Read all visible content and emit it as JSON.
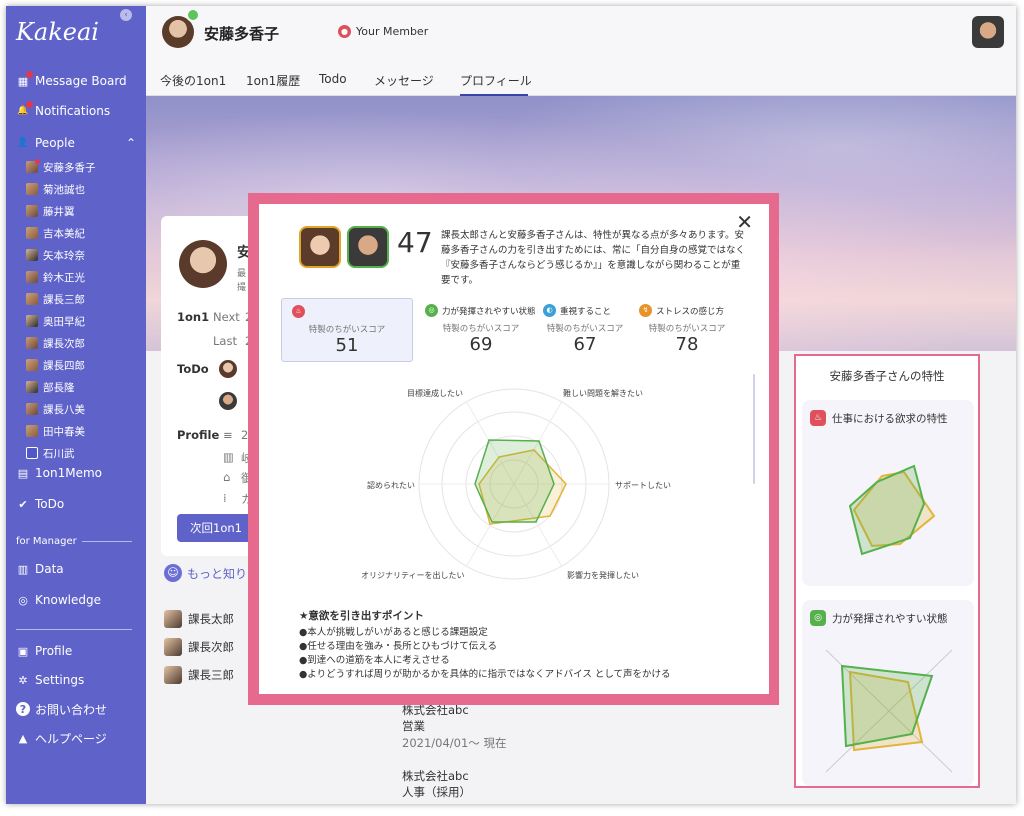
{
  "app": {
    "logo": "Kakeai",
    "collapse_glyph": "‹"
  },
  "sidebar": {
    "items": [
      {
        "label": "Message Board",
        "icon": "message-board-icon",
        "glyph": "▦",
        "badge": true
      },
      {
        "label": "Notifications",
        "icon": "bell-icon",
        "glyph": "🔔",
        "badge": true
      },
      {
        "label": "People",
        "icon": "person-icon",
        "glyph": "👤",
        "chevron": "⌃"
      }
    ],
    "people": [
      "安藤多香子",
      "菊池誠也",
      "藤井翼",
      "吉本美紀",
      "矢本玲奈",
      "鈴木正光",
      "課長三郎",
      "奥田早紀",
      "課長次郎",
      "課長四郎",
      "部長隆",
      "課長八美",
      "田中春美",
      "石川武"
    ],
    "items2": [
      {
        "label": "1on1Memo",
        "icon": "memo-icon",
        "glyph": "▤"
      },
      {
        "label": "ToDo",
        "icon": "check-icon",
        "glyph": "✔"
      }
    ],
    "manager_label": "for Manager",
    "manager_items": [
      {
        "label": "Data",
        "icon": "chart-icon",
        "glyph": "▥"
      },
      {
        "label": "Knowledge",
        "icon": "compass-icon",
        "glyph": "◎"
      }
    ],
    "bottom_items": [
      {
        "label": "Profile",
        "icon": "id-card-icon",
        "glyph": "▣"
      },
      {
        "label": "Settings",
        "icon": "gear-icon",
        "glyph": "✲"
      },
      {
        "label": "お問い合わせ",
        "icon": "help-icon",
        "glyph": "?"
      },
      {
        "label": "ヘルプページ",
        "icon": "graduation-cap-icon",
        "glyph": "▲"
      }
    ]
  },
  "header": {
    "name": "安藤多香子",
    "member_label": "Your Member",
    "tabs": [
      "今後の1on1",
      "1on1履歴",
      "Todo",
      "メッセージ",
      "プロフィール"
    ]
  },
  "profile_card": {
    "name_partial": "安",
    "line1": "最",
    "line2": "撮",
    "onone_label": "1on1",
    "next_label": "Next",
    "next_value": "2",
    "last_label": "Last",
    "last_value": "2",
    "todo_label": "ToDo",
    "profile_label": "Profile",
    "profile_v1": "2(",
    "profile_v2": "岐",
    "profile_v3": "御",
    "profile_v4": "カ",
    "next_button": "次回1on1"
  },
  "more_link": "もっと知りた",
  "bg_people": [
    "課長太郎",
    "課長次郎",
    "課長三郎"
  ],
  "career": {
    "company1": "株式会社abc",
    "role1": "営業",
    "period1": "2021/04/01〜 現在",
    "company2": "株式会社abc",
    "role2": "人事（採用）"
  },
  "traits_panel": {
    "title": "安藤多香子さんの特性",
    "cards": [
      {
        "label": "仕事における欲求の特性",
        "color": "#e0505a",
        "glyph": "♨"
      },
      {
        "label": "力が発揮されやすい状態",
        "color": "#56b04c",
        "glyph": "◎"
      }
    ]
  },
  "modal": {
    "close": "✕",
    "score": "47",
    "description": "課長太郎さんと安藤多香子さんは、特性が異なる点が多々あります。安藤多香子さんの力を引き出すためには、常に「自分自身の感覚ではなく『安藤多香子さんならどう感じるか』」を意識しながら関わることが重要です。",
    "tiles": [
      {
        "label": "",
        "sub": "特製のちがいスコア",
        "value": "51",
        "color": "#e0505a",
        "glyph": "♨"
      },
      {
        "label": "力が発揮されやすい状態",
        "sub": "特製のちがいスコア",
        "value": "69",
        "color": "#56b04c",
        "glyph": "◎"
      },
      {
        "label": "重視すること",
        "sub": "特製のちがいスコア",
        "value": "67",
        "color": "#3aa0d8",
        "glyph": "◐"
      },
      {
        "label": "ストレスの感じ方",
        "sub": "特製のちがいスコア",
        "value": "78",
        "color": "#e8922a",
        "glyph": "↯"
      }
    ],
    "radar_labels": [
      "目標達成したい",
      "難しい問題を解きたい",
      "サポートしたい",
      "影響力を発揮したい",
      "オリジナリティーを出したい",
      "認められたい"
    ],
    "points_title": "★意欲を引き出すポイント",
    "points": [
      "●本人が挑戦しがいがあると感じる課題設定",
      "●任せる理由を強み・長所とひもづけて伝える",
      "●到達への道筋を本人に考えさせる",
      "●よりどうすれば周りが助かるかを具体的に指示ではなくアドバイス として声をかける"
    ]
  },
  "colors": {
    "accent": "#5f63c9",
    "highlight": "#e56a8d",
    "series_a": "#e0b53a",
    "series_b": "#56b04c"
  }
}
